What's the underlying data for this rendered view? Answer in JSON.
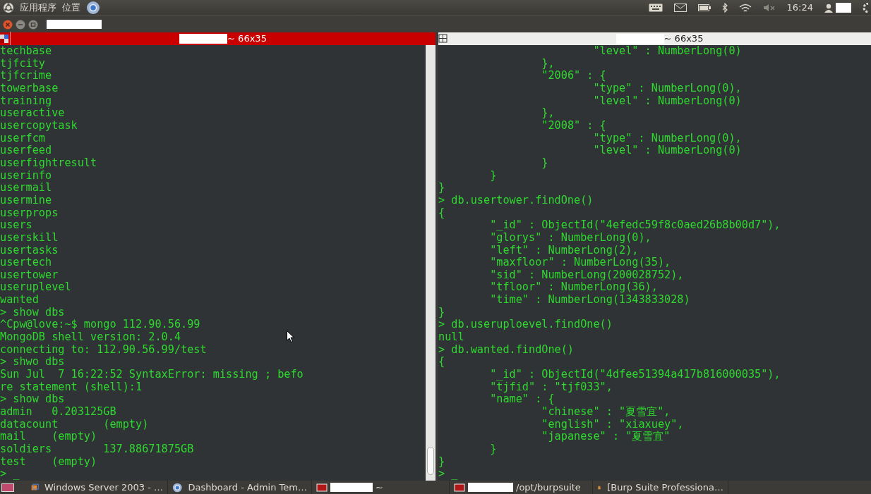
{
  "top_panel": {
    "menus": [
      {
        "label": "应用程序"
      },
      {
        "label": "位置"
      }
    ],
    "clock": "16:24"
  },
  "terminals": [
    {
      "title": "~ 66x35",
      "active": true,
      "lines": [
        "techbase",
        "tjfcity",
        "tjfcrime",
        "towerbase",
        "training",
        "useractive",
        "usercopytask",
        "userfcm",
        "userfeed",
        "userfightresult",
        "userinfo",
        "usermail",
        "usermine",
        "userprops",
        "users",
        "userskill",
        "usertasks",
        "usertech",
        "usertower",
        "useruplevel",
        "wanted",
        "> show dbs",
        "^Cpw@love:~$ mongo 112.90.56.99",
        "MongoDB shell version: 2.0.4",
        "connecting to: 112.90.56.99/test",
        "> shwo dbs",
        "Sun Jul  7 16:22:52 SyntaxError: missing ; befo",
        "re statement (shell):1",
        "> show dbs",
        "admin   0.203125GB",
        "datacount       (empty)",
        "mail    (empty)",
        "soldiers        137.88671875GB",
        "test    (empty)",
        "> _"
      ]
    },
    {
      "title": "~ 66x35",
      "active": false,
      "lines": [
        "\t\t\t\"level\" : NumberLong(0)",
        "\t\t},",
        "\t\t\"2006\" : {",
        "\t\t\t\"type\" : NumberLong(0),",
        "\t\t\t\"level\" : NumberLong(0)",
        "\t\t},",
        "\t\t\"2008\" : {",
        "\t\t\t\"type\" : NumberLong(0),",
        "\t\t\t\"level\" : NumberLong(0)",
        "\t\t}",
        "\t}",
        "}",
        "> db.usertower.findOne()",
        "{",
        "\t\"_id\" : ObjectId(\"4efedc59f8c0aed26b8b00d7\"),",
        "\t\"glorys\" : NumberLong(0),",
        "\t\"left\" : NumberLong(2),",
        "\t\"maxfloor\" : NumberLong(35),",
        "\t\"sid\" : NumberLong(200028752),",
        "\t\"tfloor\" : NumberLong(36),",
        "\t\"time\" : NumberLong(1343833028)",
        "}",
        "> db.useruploevel.findOne()",
        "null",
        "> db.wanted.findOne()",
        "{",
        "\t\"_id\" : ObjectId(\"4dfee51394a417b816000035\"),",
        "\t\"tjfid\" : \"tjf033\",",
        "\t\"name\" : {",
        "\t\t\"chinese\" : \"夏雪宜\",",
        "\t\t\"english\" : \"xiaxuey\",",
        "\t\t\"japanese\" : \"夏雪宜\"",
        "\t}",
        "}",
        "> _"
      ]
    }
  ],
  "taskbar": [
    {
      "kind": "vm",
      "label": "Windows Server 2003 - …"
    },
    {
      "kind": "browser",
      "label": "Dashboard - Admin Tem…"
    },
    {
      "kind": "terminal",
      "label": "~"
    },
    {
      "kind": "terminal",
      "label": "/opt/burpsuite"
    },
    {
      "kind": "java",
      "label": "[Burp Suite Professiona…"
    }
  ]
}
